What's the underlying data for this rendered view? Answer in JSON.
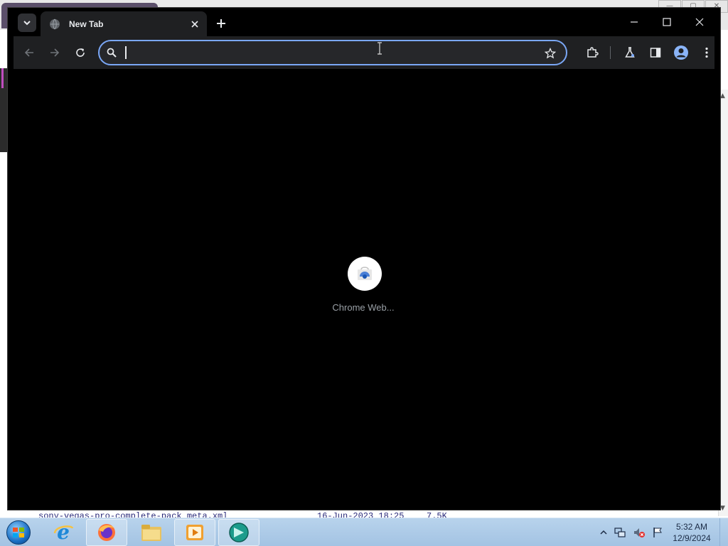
{
  "background": {
    "window_controls": [
      "—",
      "▢",
      "✕"
    ],
    "listing": {
      "filename": "sony-vegas-pro-complete-pack_meta.xml",
      "date": "16-Jun-2023 18:25",
      "size": "7.5K"
    }
  },
  "browser": {
    "tab": {
      "title": "New Tab"
    },
    "window_buttons": {
      "minimize": "minimize",
      "maximize": "maximize",
      "close": "close"
    },
    "omnibox": {
      "value": "",
      "placeholder": ""
    },
    "shortcut": {
      "label": "Chrome Web..."
    }
  },
  "taskbar": {
    "apps": [
      "Internet Explorer",
      "Firefox",
      "Windows Explorer",
      "Media Player",
      "Chrome"
    ],
    "clock": {
      "time": "5:32 AM",
      "date": "12/9/2024"
    }
  },
  "colors": {
    "omnibox_focus": "#7aa7f6",
    "toolbar_bg": "#1f2022",
    "content_bg": "#000000",
    "taskbar_bg": "#a3c3e3"
  }
}
